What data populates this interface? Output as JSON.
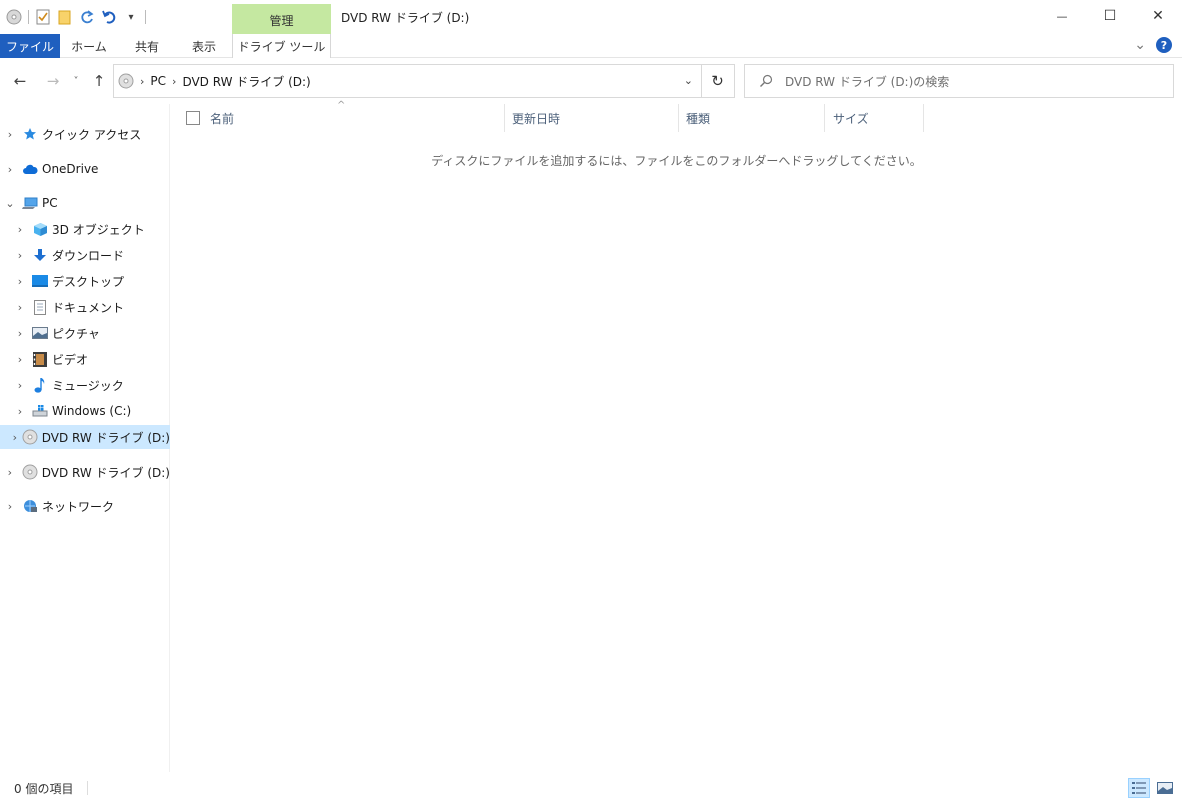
{
  "titlebar": {
    "context_group": "管理",
    "window_title": "DVD RW ドライブ (D:)",
    "dropdown_glyph": "▾",
    "minimize": "—",
    "maximize": "☐",
    "close": "✕"
  },
  "ribbon": {
    "tabs": [
      "ファイル",
      "ホーム",
      "共有",
      "表示",
      "ドライブ ツール"
    ],
    "expand": "⌄",
    "help": "?"
  },
  "address": {
    "back": "←",
    "forward": "→",
    "recent": "˅",
    "up": "↑",
    "chevron": "›",
    "crumbs": [
      "PC",
      "DVD RW ドライブ (D:)"
    ],
    "dropdown": "⌄",
    "refresh": "↻",
    "search_placeholder": "DVD RW ドライブ (D:)の検索"
  },
  "nav": {
    "expand_glyph": "›",
    "collapse_glyph": "⌄",
    "items": [
      {
        "label": "クイック アクセス",
        "icon": "star-icon"
      },
      {
        "label": "OneDrive",
        "icon": "cloud-icon"
      },
      {
        "label": "PC",
        "icon": "pc-icon"
      },
      {
        "label": "3D オブジェクト",
        "icon": "cube-icon"
      },
      {
        "label": "ダウンロード",
        "icon": "download-icon"
      },
      {
        "label": "デスクトップ",
        "icon": "desktop-icon"
      },
      {
        "label": "ドキュメント",
        "icon": "document-icon"
      },
      {
        "label": "ピクチャ",
        "icon": "picture-icon"
      },
      {
        "label": "ビデオ",
        "icon": "video-icon"
      },
      {
        "label": "ミュージック",
        "icon": "music-icon"
      },
      {
        "label": "Windows (C:)",
        "icon": "windows-drive-icon"
      },
      {
        "label": "DVD RW ドライブ (D:)",
        "icon": "dvd-drive-icon"
      },
      {
        "label": "DVD RW ドライブ (D:)",
        "icon": "dvd-drive-icon"
      },
      {
        "label": "ネットワーク",
        "icon": "network-icon"
      }
    ]
  },
  "content": {
    "sort_caret": "^",
    "columns": [
      "名前",
      "更新日時",
      "種類",
      "サイズ"
    ],
    "empty_message": "ディスクにファイルを追加するには、ファイルをこのフォルダーへドラッグしてください。"
  },
  "status": {
    "item_count": "0 個の項目"
  },
  "colors": {
    "accent": "#1f5fbf",
    "context_tab": "#c5e8a1",
    "selection": "#cce8ff"
  }
}
